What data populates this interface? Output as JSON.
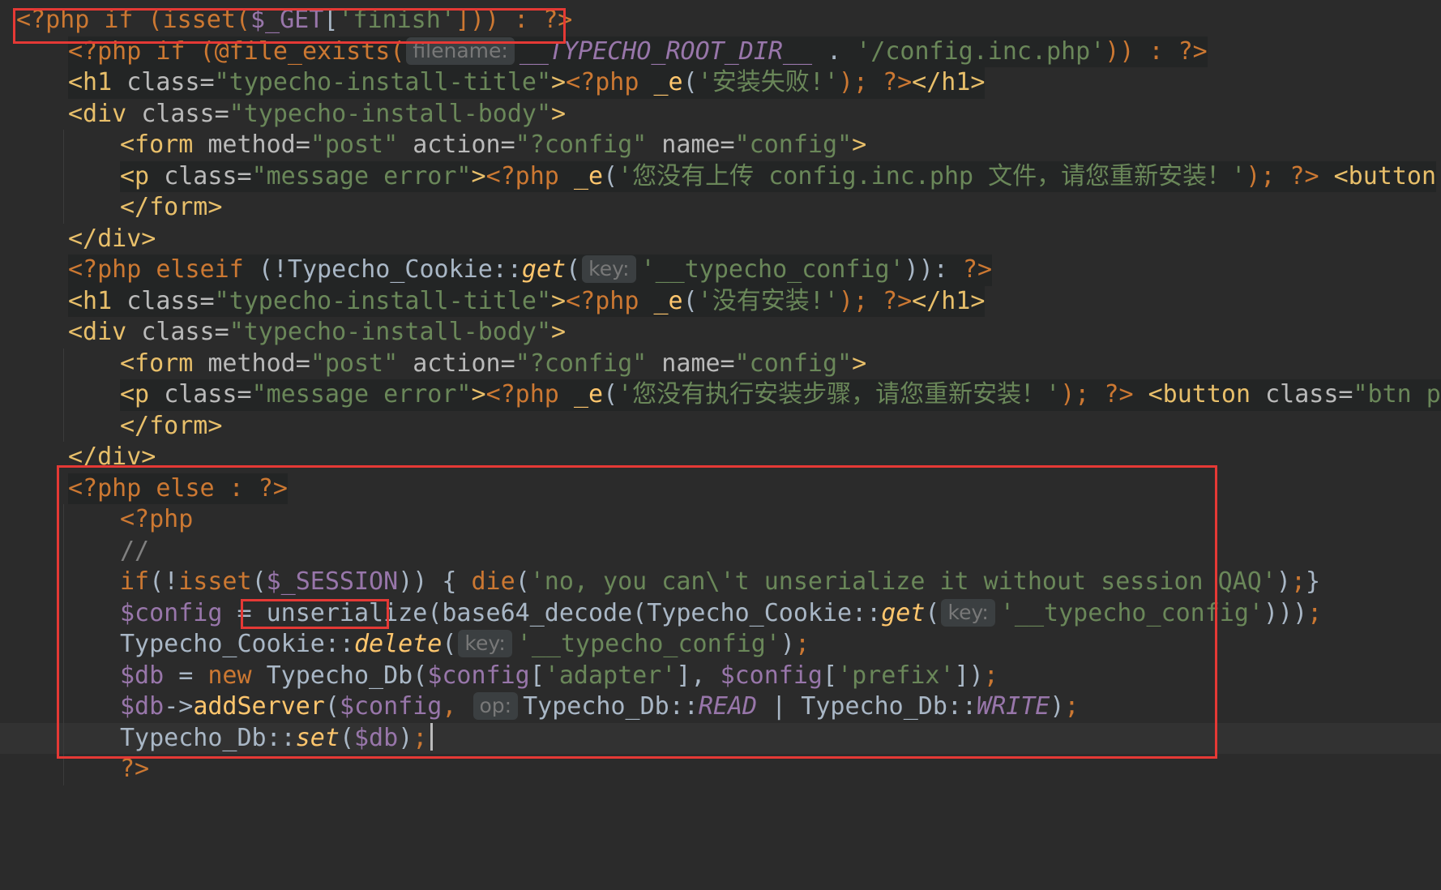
{
  "editor": {
    "lines": [
      {
        "id": 1,
        "segments": [
          {
            "t": "<?php if (isset(",
            "c": "php"
          },
          {
            "t": "$_GET",
            "c": "var"
          },
          {
            "t": "[",
            "c": "plain"
          },
          {
            "t": "'finish'",
            "c": "str"
          },
          {
            "t": "])) : ?>",
            "c": "php"
          }
        ]
      },
      {
        "id": 2,
        "segments": [
          {
            "t": "<?php if (@file_exists(",
            "c": "php"
          },
          {
            "t": "filename:",
            "c": "hint"
          },
          {
            "t": "__TYPECHO_ROOT_DIR__",
            "c": "const"
          },
          {
            "t": " . ",
            "c": "plain"
          },
          {
            "t": "'/config.inc.php'",
            "c": "str"
          },
          {
            "t": ")) : ?>",
            "c": "php"
          }
        ]
      },
      {
        "id": 3,
        "segments": [
          {
            "t": "<h1 ",
            "c": "tag"
          },
          {
            "t": "class=",
            "c": "attr"
          },
          {
            "t": "\"typecho-install-title\"",
            "c": "str"
          },
          {
            "t": ">",
            "c": "tag"
          },
          {
            "t": "<?php ",
            "c": "php"
          },
          {
            "t": "_e",
            "c": "fn"
          },
          {
            "t": "(",
            "c": "plain"
          },
          {
            "t": "'安装失败!'",
            "c": "str"
          },
          {
            "t": "); ?>",
            "c": "php"
          },
          {
            "t": "</h1>",
            "c": "tag"
          }
        ]
      },
      {
        "id": 4,
        "segments": [
          {
            "t": "<div ",
            "c": "tag"
          },
          {
            "t": "class=",
            "c": "attr"
          },
          {
            "t": "\"typecho-install-body\"",
            "c": "str"
          },
          {
            "t": ">",
            "c": "tag"
          }
        ]
      },
      {
        "id": 5,
        "segments": [
          {
            "t": "<form ",
            "c": "tag"
          },
          {
            "t": "method=",
            "c": "attr"
          },
          {
            "t": "\"post\"",
            "c": "str"
          },
          {
            "t": " action=",
            "c": "attr"
          },
          {
            "t": "\"?config\"",
            "c": "str"
          },
          {
            "t": " name=",
            "c": "attr"
          },
          {
            "t": "\"config\"",
            "c": "str"
          },
          {
            "t": ">",
            "c": "tag"
          }
        ]
      },
      {
        "id": 6,
        "segments": [
          {
            "t": "<p ",
            "c": "tag"
          },
          {
            "t": "class=",
            "c": "attr"
          },
          {
            "t": "\"message error\"",
            "c": "str"
          },
          {
            "t": ">",
            "c": "tag"
          },
          {
            "t": "<?php ",
            "c": "php"
          },
          {
            "t": "_e",
            "c": "fn"
          },
          {
            "t": "(",
            "c": "plain"
          },
          {
            "t": "'您没有上传 config.inc.php 文件，请您重新安装！'",
            "c": "str"
          },
          {
            "t": "); ?>",
            "c": "php"
          },
          {
            "t": " <button",
            "c": "tag"
          }
        ]
      },
      {
        "id": 7,
        "segments": [
          {
            "t": "</form>",
            "c": "tag"
          }
        ]
      },
      {
        "id": 8,
        "segments": [
          {
            "t": "</div>",
            "c": "tag"
          }
        ]
      },
      {
        "id": 9,
        "segments": [
          {
            "t": "<?php elseif ",
            "c": "php"
          },
          {
            "t": "(!Typecho_Cookie::",
            "c": "plain"
          },
          {
            "t": "get",
            "c": "ital"
          },
          {
            "t": "(",
            "c": "plain"
          },
          {
            "t": "key:",
            "c": "hint"
          },
          {
            "t": "'__typecho_config'",
            "c": "str"
          },
          {
            "t": ")): ",
            "c": "plain"
          },
          {
            "t": "?>",
            "c": "php"
          }
        ]
      },
      {
        "id": 10,
        "segments": [
          {
            "t": "<h1 ",
            "c": "tag"
          },
          {
            "t": "class=",
            "c": "attr"
          },
          {
            "t": "\"typecho-install-title\"",
            "c": "str"
          },
          {
            "t": ">",
            "c": "tag"
          },
          {
            "t": "<?php ",
            "c": "php"
          },
          {
            "t": "_e",
            "c": "fn"
          },
          {
            "t": "(",
            "c": "plain"
          },
          {
            "t": "'没有安装!'",
            "c": "str"
          },
          {
            "t": "); ?>",
            "c": "php"
          },
          {
            "t": "</h1>",
            "c": "tag"
          }
        ]
      },
      {
        "id": 11,
        "segments": [
          {
            "t": "<div ",
            "c": "tag"
          },
          {
            "t": "class=",
            "c": "attr"
          },
          {
            "t": "\"typecho-install-body\"",
            "c": "str"
          },
          {
            "t": ">",
            "c": "tag"
          }
        ]
      },
      {
        "id": 12,
        "segments": [
          {
            "t": "<form ",
            "c": "tag"
          },
          {
            "t": "method=",
            "c": "attr"
          },
          {
            "t": "\"post\"",
            "c": "str"
          },
          {
            "t": " action=",
            "c": "attr"
          },
          {
            "t": "\"?config\"",
            "c": "str"
          },
          {
            "t": " name=",
            "c": "attr"
          },
          {
            "t": "\"config\"",
            "c": "str"
          },
          {
            "t": ">",
            "c": "tag"
          }
        ]
      },
      {
        "id": 13,
        "segments": [
          {
            "t": "<p ",
            "c": "tag"
          },
          {
            "t": "class=",
            "c": "attr"
          },
          {
            "t": "\"message error\"",
            "c": "str"
          },
          {
            "t": ">",
            "c": "tag"
          },
          {
            "t": "<?php ",
            "c": "php"
          },
          {
            "t": "_e",
            "c": "fn"
          },
          {
            "t": "(",
            "c": "plain"
          },
          {
            "t": "'您没有执行安装步骤，请您重新安装！'",
            "c": "str"
          },
          {
            "t": "); ?>",
            "c": "php"
          },
          {
            "t": " <button ",
            "c": "tag"
          },
          {
            "t": "class=",
            "c": "attr"
          },
          {
            "t": "\"btn p",
            "c": "str"
          }
        ]
      },
      {
        "id": 14,
        "segments": [
          {
            "t": "</form>",
            "c": "tag"
          }
        ]
      },
      {
        "id": 15,
        "segments": [
          {
            "t": "</div>",
            "c": "tag"
          }
        ]
      },
      {
        "id": 16,
        "segments": [
          {
            "t": "<?php else : ?>",
            "c": "php"
          }
        ]
      },
      {
        "id": 17,
        "segments": [
          {
            "t": "<?php",
            "c": "php"
          }
        ]
      },
      {
        "id": 18,
        "segments": [
          {
            "t": "//",
            "c": "comment"
          }
        ]
      },
      {
        "id": 19,
        "segments": [
          {
            "t": "if",
            "c": "kw"
          },
          {
            "t": "(!",
            "c": "plain"
          },
          {
            "t": "isset",
            "c": "kw"
          },
          {
            "t": "(",
            "c": "plain"
          },
          {
            "t": "$_SESSION",
            "c": "var"
          },
          {
            "t": ")) { ",
            "c": "plain"
          },
          {
            "t": "die",
            "c": "kw"
          },
          {
            "t": "(",
            "c": "plain"
          },
          {
            "t": "'no, you can\\'t unserialize it without session QAQ'",
            "c": "str"
          },
          {
            "t": ")",
            "c": "plain"
          },
          {
            "t": ";",
            "c": "kw"
          },
          {
            "t": "}",
            "c": "plain"
          }
        ]
      },
      {
        "id": 20,
        "segments": [
          {
            "t": "$config",
            "c": "var"
          },
          {
            "t": " = ",
            "c": "plain"
          },
          {
            "t": "unserialize",
            "c": "plain"
          },
          {
            "t": "(base64_decode(Typecho_Cookie::",
            "c": "plain"
          },
          {
            "t": "get",
            "c": "ital"
          },
          {
            "t": "(",
            "c": "plain"
          },
          {
            "t": "key:",
            "c": "hint"
          },
          {
            "t": "'__typecho_config'",
            "c": "str"
          },
          {
            "t": ")))",
            "c": "plain"
          },
          {
            "t": ";",
            "c": "kw"
          }
        ]
      },
      {
        "id": 21,
        "segments": [
          {
            "t": "Typecho_Cookie::",
            "c": "plain"
          },
          {
            "t": "delete",
            "c": "ital"
          },
          {
            "t": "(",
            "c": "plain"
          },
          {
            "t": "key:",
            "c": "hint"
          },
          {
            "t": "'__typecho_config'",
            "c": "str"
          },
          {
            "t": ")",
            "c": "plain"
          },
          {
            "t": ";",
            "c": "kw"
          }
        ]
      },
      {
        "id": 22,
        "segments": [
          {
            "t": "$db",
            "c": "var"
          },
          {
            "t": " = ",
            "c": "plain"
          },
          {
            "t": "new ",
            "c": "kw"
          },
          {
            "t": "Typecho_Db(",
            "c": "plain"
          },
          {
            "t": "$config",
            "c": "var"
          },
          {
            "t": "[",
            "c": "plain"
          },
          {
            "t": "'adapter'",
            "c": "str"
          },
          {
            "t": "], ",
            "c": "plain"
          },
          {
            "t": "$config",
            "c": "var"
          },
          {
            "t": "[",
            "c": "plain"
          },
          {
            "t": "'prefix'",
            "c": "str"
          },
          {
            "t": "])",
            "c": "plain"
          },
          {
            "t": ";",
            "c": "kw"
          }
        ]
      },
      {
        "id": 23,
        "segments": [
          {
            "t": "$db",
            "c": "var"
          },
          {
            "t": "->",
            "c": "plain"
          },
          {
            "t": "addServer",
            "c": "fn"
          },
          {
            "t": "(",
            "c": "plain"
          },
          {
            "t": "$config",
            "c": "var"
          },
          {
            "t": ", ",
            "c": "kw"
          },
          {
            "t": "op:",
            "c": "hint"
          },
          {
            "t": "Typecho_Db::",
            "c": "plain"
          },
          {
            "t": "READ",
            "c": "const"
          },
          {
            "t": " | Typecho_Db::",
            "c": "plain"
          },
          {
            "t": "WRITE",
            "c": "const"
          },
          {
            "t": ")",
            "c": "plain"
          },
          {
            "t": ";",
            "c": "kw"
          }
        ]
      },
      {
        "id": 24,
        "segments": [
          {
            "t": "Typecho_Db::",
            "c": "plain"
          },
          {
            "t": "set",
            "c": "ital"
          },
          {
            "t": "(",
            "c": "plain"
          },
          {
            "t": "$db",
            "c": "var"
          },
          {
            "t": ")",
            "c": "plain"
          },
          {
            "t": ";",
            "c": "kw"
          }
        ]
      },
      {
        "id": 25,
        "segments": [
          {
            "t": "?>",
            "c": "php"
          }
        ]
      }
    ]
  }
}
